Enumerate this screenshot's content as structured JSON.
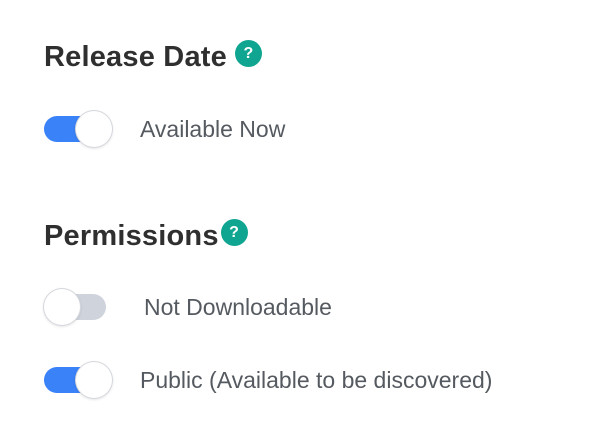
{
  "release": {
    "title": "Release Date",
    "help_icon": "?",
    "toggle": {
      "label": "Available Now",
      "state": "on"
    }
  },
  "permissions": {
    "title": "Permissions",
    "help_icon": "?",
    "toggles": [
      {
        "label": "Not Downloadable",
        "state": "off"
      },
      {
        "label": "Public (Available to be discovered)",
        "state": "on"
      }
    ]
  },
  "colors": {
    "toggle_on": "#3a82f7",
    "toggle_off": "#cfd3db",
    "help_icon": "#10a591",
    "title_text": "#2f2f2f",
    "label_text": "#555a60"
  }
}
